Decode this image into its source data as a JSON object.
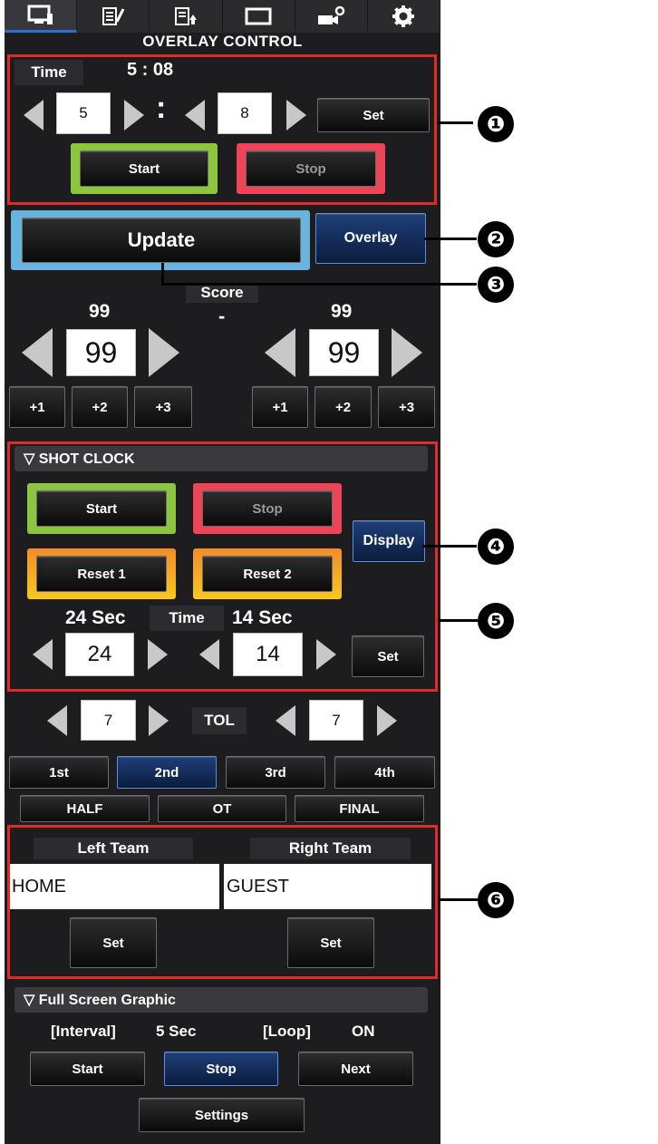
{
  "tabs": [
    {
      "icon": "monitor-icon"
    },
    {
      "icon": "edit-list-icon"
    },
    {
      "icon": "upload-list-icon"
    },
    {
      "icon": "screen-icon"
    },
    {
      "icon": "camera-settings-icon"
    },
    {
      "icon": "gear-icon"
    }
  ],
  "title": "OVERLAY CONTROL",
  "game_clock": {
    "label": "Time",
    "display": "5 : 08",
    "minutes": "5",
    "separator": ":",
    "seconds": "8",
    "set_label": "Set",
    "start_label": "Start",
    "stop_label": "Stop"
  },
  "update_label": "Update",
  "overlay_label": "Overlay",
  "score": {
    "label": "Score",
    "dash": "-",
    "left": {
      "display": "99",
      "value": "99",
      "plus1": "+1",
      "plus2": "+2",
      "plus3": "+3"
    },
    "right": {
      "display": "99",
      "value": "99",
      "plus1": "+1",
      "plus2": "+2",
      "plus3": "+3"
    }
  },
  "shot_clock": {
    "header": "▽ SHOT CLOCK",
    "start_label": "Start",
    "stop_label": "Stop",
    "reset1_label": "Reset 1",
    "reset2_label": "Reset 2",
    "display_label": "Display",
    "sec24_label": "24 Sec",
    "time_label": "Time",
    "sec14_label": "14 Sec",
    "value24": "24",
    "value14": "14",
    "set_label": "Set"
  },
  "tol": {
    "label": "TOL",
    "left_value": "7",
    "right_value": "7"
  },
  "periods": [
    "1st",
    "2nd",
    "3rd",
    "4th"
  ],
  "period_states": [
    "HALF",
    "OT",
    "FINAL"
  ],
  "teams": {
    "left_label": "Left Team",
    "right_label": "Right Team",
    "left_value": "HOME",
    "right_value": "GUEST",
    "set_label": "Set"
  },
  "full_screen": {
    "header": "▽ Full Screen Graphic",
    "interval_label": "[Interval]",
    "interval_value": "5 Sec",
    "loop_label": "[Loop]",
    "loop_value": "ON",
    "start_label": "Start",
    "stop_label": "Stop",
    "next_label": "Next",
    "settings_label": "Settings"
  },
  "callouts": [
    "❶",
    "❷",
    "❸",
    "❹",
    "❺",
    "❻"
  ],
  "colors": {
    "panel": "#1d1d1f",
    "highlight_red": "#e02b2b",
    "green_frame": "#8cc63f",
    "red_frame": "#ef4357",
    "orange_frame": "#f5a623",
    "blue_frame": "#69b4de",
    "active_blue": "#1e3f7a"
  }
}
